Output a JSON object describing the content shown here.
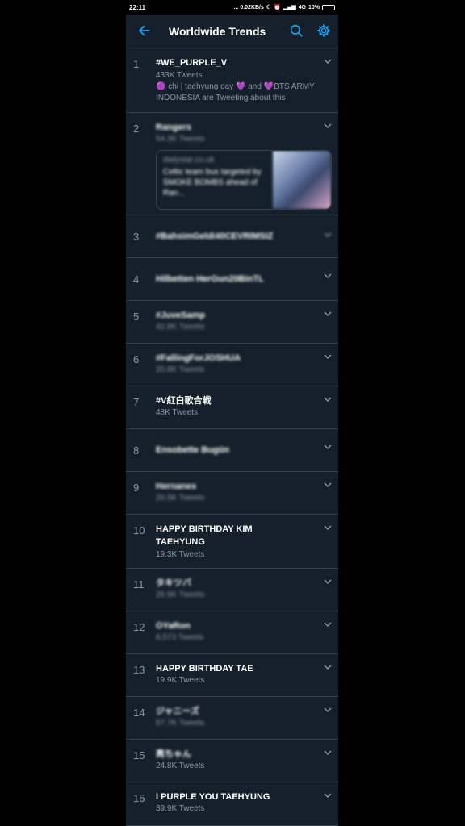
{
  "status_bar": {
    "time": "22:11",
    "net_speed": "... 0.02KB/s",
    "network": "4G",
    "battery": "10%"
  },
  "header": {
    "title": "Worldwide Trends",
    "back_icon": "arrow-left-icon",
    "search_icon": "search-icon",
    "settings_icon": "gear-icon"
  },
  "trends": [
    {
      "rank": "1",
      "name": "#WE_PURPLE_V",
      "count": "433K Tweets",
      "context": "🟣 chi | taehyung day 💜 and 💜BTS ARMY INDONESIA are Tweeting about this"
    },
    {
      "rank": "2",
      "name": "Rangers",
      "count": "54.3K Tweets",
      "card_source": "dailystar.co.uk",
      "card_headline": "Celtic team bus targeted by SMOKE BOMBS ahead of Ran..."
    },
    {
      "rank": "3",
      "name": "#BahsimGeldi40CEVRIMSIZ",
      "count": ""
    },
    {
      "rank": "4",
      "name": "Hilbetten HerGun20BinTL",
      "count": ""
    },
    {
      "rank": "5",
      "name": "#JuveSamp",
      "count": "42.8K Tweets"
    },
    {
      "rank": "6",
      "name": "#FallingForJOSHUA",
      "count": "20.8K Tweets"
    },
    {
      "rank": "7",
      "name": "#V紅白歌合戦",
      "count": "48K Tweets"
    },
    {
      "rank": "8",
      "name": "Ensobette Bugün",
      "count": ""
    },
    {
      "rank": "9",
      "name": "Hernanes",
      "count": "20.5K Tweets"
    },
    {
      "rank": "10",
      "name": "HAPPY BIRTHDAY KIM TAEHYUNG",
      "count": "19.3K Tweets"
    },
    {
      "rank": "11",
      "name": "タキツバ",
      "count": "26.9K Tweets"
    },
    {
      "rank": "12",
      "name": "OYaRon",
      "count": "8,573 Tweets"
    },
    {
      "rank": "13",
      "name": "HAPPY BIRTHDAY TAE",
      "count": "19.9K Tweets"
    },
    {
      "rank": "14",
      "name": "ジャニーズ",
      "count": "57.7K Tweets"
    },
    {
      "rank": "15",
      "name": "亮ちゃん",
      "count": "24.8K Tweets"
    },
    {
      "rank": "16",
      "name": "I PURPLE YOU TAEHYUNG",
      "count": "39.9K Tweets"
    }
  ]
}
